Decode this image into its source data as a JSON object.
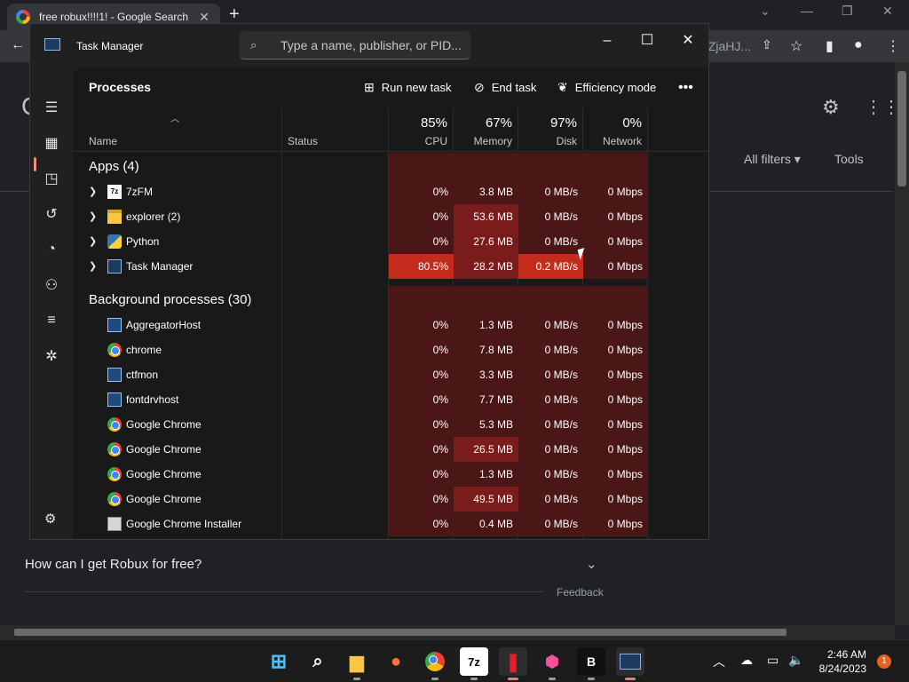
{
  "browser": {
    "tab_title": "free robux!!!!1! - Google Search",
    "omnibox_tail": "gZjaHJ...",
    "page": {
      "all_filters": "All filters",
      "tools": "Tools",
      "question": "How can I get Robux for free?",
      "feedback": "Feedback"
    }
  },
  "taskmanager": {
    "title": "Task Manager",
    "search_placeholder": "Type a name, publisher, or PID...",
    "page_title": "Processes",
    "actions": {
      "run_new_task": "Run new task",
      "end_task": "End task",
      "efficiency_mode": "Efficiency mode"
    },
    "columns": {
      "name": "Name",
      "status": "Status",
      "cpu_pct": "85%",
      "cpu": "CPU",
      "mem_pct": "67%",
      "mem": "Memory",
      "disk_pct": "97%",
      "disk": "Disk",
      "net_pct": "0%",
      "net": "Network"
    },
    "groups": {
      "apps": "Apps (4)",
      "background": "Background processes (30)"
    },
    "apps": [
      {
        "name": "7zFM",
        "icon": "7z-icon",
        "cpu": "0%",
        "mem": "3.8 MB",
        "disk": "0 MB/s",
        "net": "0 Mbps"
      },
      {
        "name": "explorer (2)",
        "icon": "folder-icon",
        "cpu": "0%",
        "mem": "53.6 MB",
        "disk": "0 MB/s",
        "net": "0 Mbps"
      },
      {
        "name": "Python",
        "icon": "python-icon",
        "cpu": "0%",
        "mem": "27.6 MB",
        "disk": "0 MB/s",
        "net": "0 Mbps"
      },
      {
        "name": "Task Manager",
        "icon": "taskmanager-icon",
        "cpu": "80.5%",
        "mem": "28.2 MB",
        "disk": "0.2 MB/s",
        "net": "0 Mbps"
      }
    ],
    "background": [
      {
        "name": "AggregatorHost",
        "icon": "window-icon",
        "cpu": "0%",
        "mem": "1.3 MB",
        "disk": "0 MB/s",
        "net": "0 Mbps"
      },
      {
        "name": "chrome",
        "icon": "chrome-icon",
        "cpu": "0%",
        "mem": "7.8 MB",
        "disk": "0 MB/s",
        "net": "0 Mbps"
      },
      {
        "name": "ctfmon",
        "icon": "window-icon",
        "cpu": "0%",
        "mem": "3.3 MB",
        "disk": "0 MB/s",
        "net": "0 Mbps"
      },
      {
        "name": "fontdrvhost",
        "icon": "window-icon",
        "cpu": "0%",
        "mem": "7.7 MB",
        "disk": "0 MB/s",
        "net": "0 Mbps"
      },
      {
        "name": "Google Chrome",
        "icon": "chrome-icon",
        "cpu": "0%",
        "mem": "5.3 MB",
        "disk": "0 MB/s",
        "net": "0 Mbps"
      },
      {
        "name": "Google Chrome",
        "icon": "chrome-icon",
        "cpu": "0%",
        "mem": "26.5 MB",
        "disk": "0 MB/s",
        "net": "0 Mbps"
      },
      {
        "name": "Google Chrome",
        "icon": "chrome-icon",
        "cpu": "0%",
        "mem": "1.3 MB",
        "disk": "0 MB/s",
        "net": "0 Mbps"
      },
      {
        "name": "Google Chrome",
        "icon": "chrome-icon",
        "cpu": "0%",
        "mem": "49.5 MB",
        "disk": "0 MB/s",
        "net": "0 Mbps"
      },
      {
        "name": "Google Chrome Installer",
        "icon": "installer-icon",
        "cpu": "0%",
        "mem": "0.4 MB",
        "disk": "0 MB/s",
        "net": "0 Mbps"
      }
    ]
  },
  "taskbar": {
    "time": "2:46 AM",
    "date": "8/24/2023",
    "notifications": "1"
  },
  "colors": {
    "heat_low": "#4a1616",
    "heat_mid": "#7a1c1c",
    "heat_high": "#c42b1c",
    "accent": "#f28b82"
  }
}
